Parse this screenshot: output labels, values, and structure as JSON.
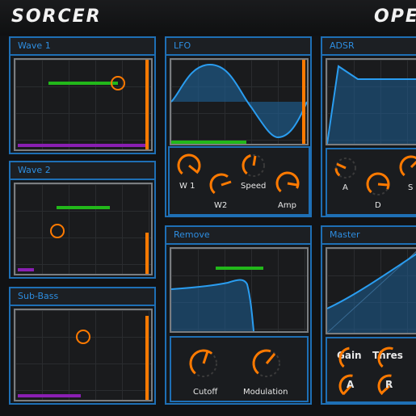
{
  "header": {
    "brand": "SORCER",
    "right_label": "OPE"
  },
  "wave1": {
    "title": "Wave 1"
  },
  "wave2": {
    "title": "Wave 2"
  },
  "subbass": {
    "title": "Sub-Bass"
  },
  "lfo": {
    "title": "LFO",
    "knobs": {
      "w1": "W 1",
      "w2": "W2",
      "speed": "Speed",
      "amp": "Amp"
    }
  },
  "remove": {
    "title": "Remove",
    "knobs": {
      "cutoff": "Cutoff",
      "modulation": "Modulation"
    }
  },
  "adsr": {
    "title": "ADSR",
    "knobs": {
      "a": "A",
      "d": "D",
      "s": "S"
    }
  },
  "master": {
    "title": "Master",
    "knobs": {
      "gain": "Gain",
      "thres": "Thres",
      "a": "A",
      "r": "R"
    }
  },
  "colors": {
    "accent_blue": "#1e6fb5",
    "knob_orange": "#ff7a00",
    "level_green": "#22b81a",
    "level_purple": "#8a1fb3"
  }
}
